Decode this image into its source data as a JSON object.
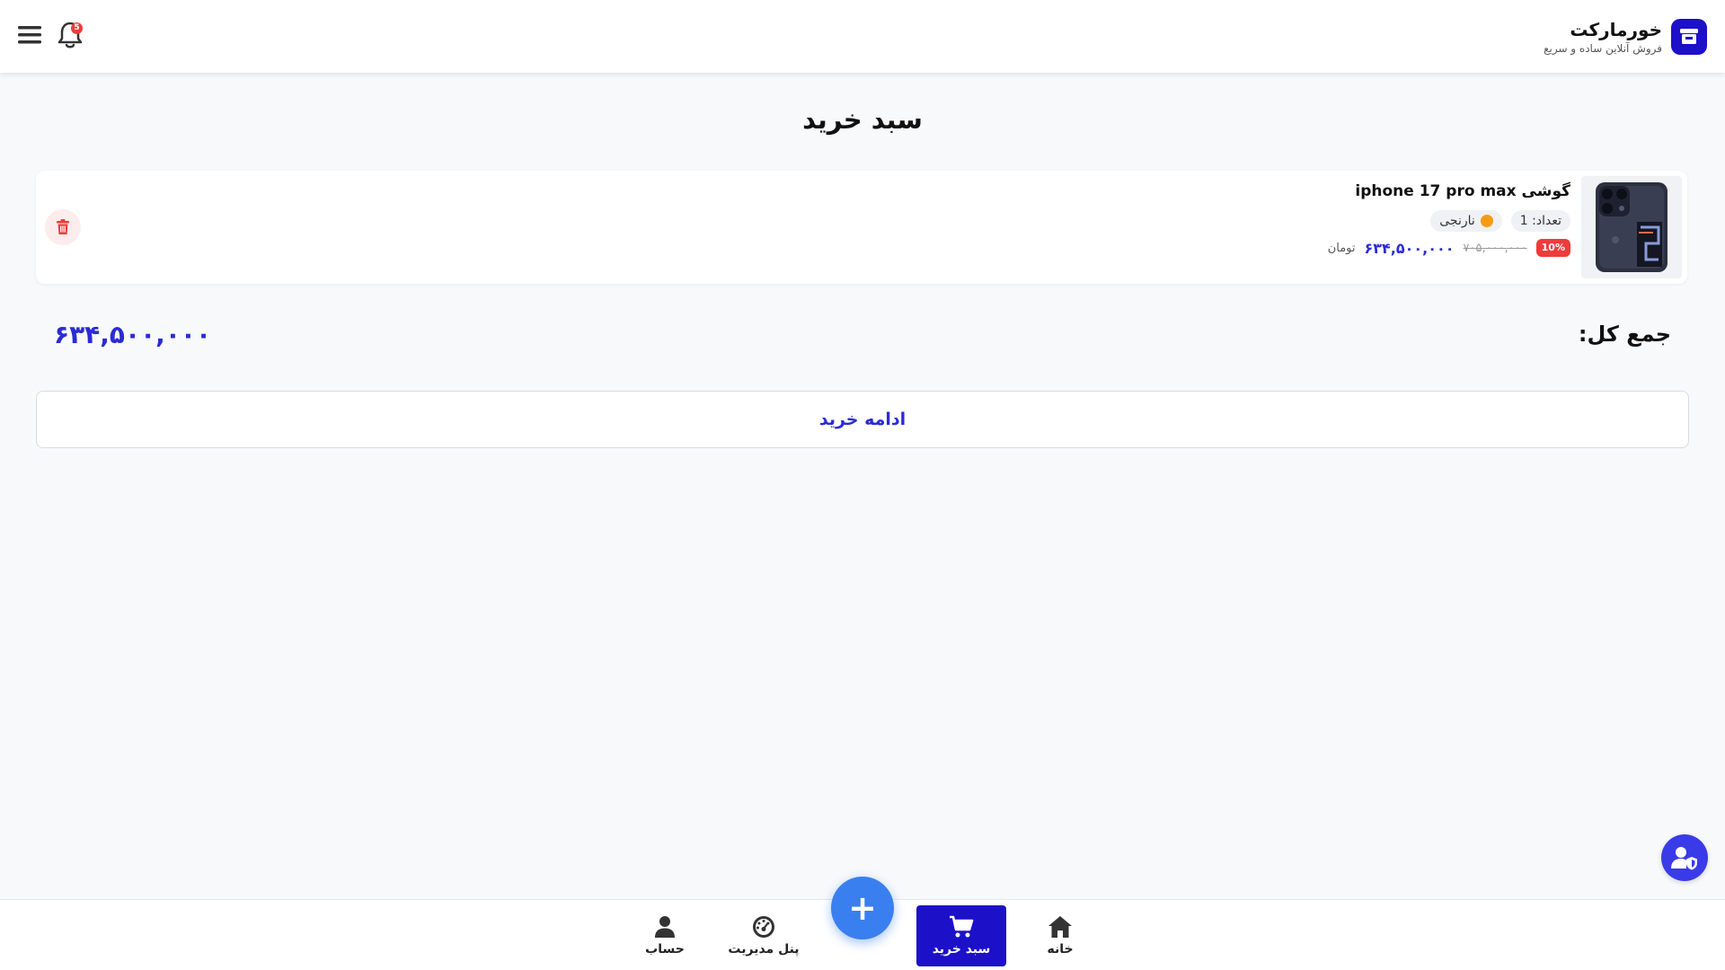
{
  "header": {
    "brand_name": "خورمارکت",
    "brand_tagline": "فروش آنلاین ساده و سریع",
    "notification_count": "5"
  },
  "page": {
    "title": "سبد خرید"
  },
  "cart": {
    "items": [
      {
        "name": "گوشی iphone 17 pro max",
        "quantity_label": "تعداد: 1",
        "color_label": "نارنجی",
        "color_hex": "#f59b10",
        "discount": "10%",
        "old_price": "۷۰۵,۰۰۰,۰۰۰",
        "new_price": "۶۳۴,۵۰۰,۰۰۰",
        "currency": "تومان"
      }
    ],
    "total_label": "جمع کل:",
    "total_value": "۶۳۴,۵۰۰,۰۰۰",
    "continue_label": "ادامه خرید"
  },
  "bottom_nav": {
    "home": "خانه",
    "cart": "سبد خرید",
    "admin_panel": "پنل مدیریت",
    "account": "حساب",
    "fab": "+"
  },
  "colors": {
    "brand": "#1c10c9",
    "accent_blue": "#2b2bd6",
    "fab_blue": "#3a7ff0",
    "danger": "#ef3b3b"
  },
  "icons": {
    "brand_logo": "store-icon",
    "menu": "hamburger-menu-icon",
    "notifications": "bell-icon",
    "delete": "trash-icon",
    "home": "home-icon",
    "cart": "cart-icon",
    "admin": "dashboard-gauge-icon",
    "account": "user-icon",
    "support": "user-shield-icon"
  }
}
